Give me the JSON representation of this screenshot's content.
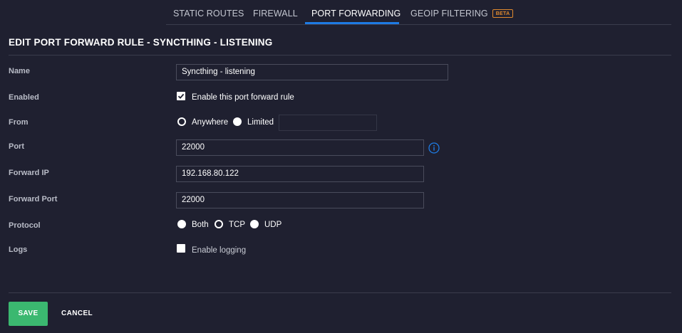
{
  "tabs": [
    {
      "label": "STATIC ROUTES"
    },
    {
      "label": "FIREWALL"
    },
    {
      "label": "PORT FORWARDING"
    },
    {
      "label": "GEOIP FILTERING",
      "badge": "BETA"
    }
  ],
  "active_tab": "PORT FORWARDING",
  "title": "EDIT PORT FORWARD RULE - SYNCTHING - LISTENING",
  "form": {
    "name": {
      "label": "Name",
      "value": "Syncthing - listening"
    },
    "enabled": {
      "label": "Enabled",
      "checkbox_label": "Enable this port forward rule",
      "checked": true
    },
    "from": {
      "label": "From",
      "options": [
        "Anywhere",
        "Limited"
      ],
      "selected": "Anywhere",
      "limited_value": ""
    },
    "port": {
      "label": "Port",
      "value": "22000",
      "info_icon": "info-icon"
    },
    "forward_ip": {
      "label": "Forward IP",
      "value": "192.168.80.122"
    },
    "forward_port": {
      "label": "Forward Port",
      "value": "22000"
    },
    "protocol": {
      "label": "Protocol",
      "options": [
        "Both",
        "TCP",
        "UDP"
      ],
      "selected": "TCP"
    },
    "logs": {
      "label": "Logs",
      "checkbox_label": "Enable logging",
      "checked": false
    }
  },
  "actions": {
    "save": "SAVE",
    "cancel": "CANCEL"
  },
  "colors": {
    "background": "#1f2030",
    "accent": "#1e7be4",
    "save": "#3bb870",
    "beta": "#e08a2e"
  }
}
